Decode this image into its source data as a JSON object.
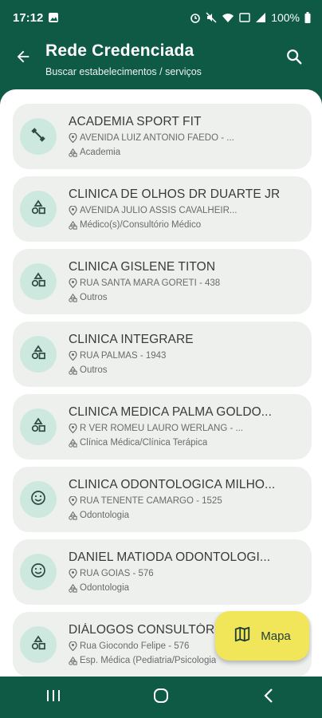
{
  "status": {
    "time": "17:12",
    "battery": "100%"
  },
  "header": {
    "title": "Rede Credenciada",
    "subtitle": "Buscar estabelecimentos / serviços"
  },
  "items": [
    {
      "name": "ACADEMIA SPORT FIT",
      "address": "AVENIDA LUIZ ANTONIO FAEDO  - ...",
      "category": "Academia",
      "icon": "dumbbell-icon"
    },
    {
      "name": "CLINICA DE OLHOS DR DUARTE JR",
      "address": "AVENIDA JULIO ASSIS CAVALHEIR...",
      "category": "Médico(s)/Consultório Médico",
      "icon": "shapes-icon"
    },
    {
      "name": "CLINICA GISLENE TITON",
      "address": "RUA SANTA MARA GORETI - 438",
      "category": "Outros",
      "icon": "shapes-icon"
    },
    {
      "name": "CLINICA INTEGRARE",
      "address": "RUA PALMAS - 1943",
      "category": "Outros",
      "icon": "shapes-icon"
    },
    {
      "name": " CLINICA MEDICA PALMA GOLDO...",
      "address": "R VER ROMEU LAURO WERLANG - ...",
      "category": "Clínica Médica/Clínica Terápica",
      "icon": "shapes-icon"
    },
    {
      "name": "CLINICA ODONTOLOGICA MILHO...",
      "address": "RUA TENENTE CAMARGO  - 1525",
      "category": "Odontologia",
      "icon": "smiley-icon"
    },
    {
      "name": "DANIEL MATIODA ODONTOLOGI...",
      "address": "RUA GOIAS  - 576",
      "category": "Odontologia",
      "icon": "smiley-icon"
    },
    {
      "name": "DIÁLOGOS CONSULTÓRIO",
      "address": "Rua Giocondo Felipe - 576",
      "category": "Esp. Médica (Pediatria/Psicologia",
      "icon": "shapes-icon"
    }
  ],
  "fab": {
    "label": "Mapa"
  },
  "colors": {
    "primary": "#0f5a44",
    "accent": "#f1e65a",
    "avatar": "#cde9df",
    "card": "#eef0ee"
  }
}
